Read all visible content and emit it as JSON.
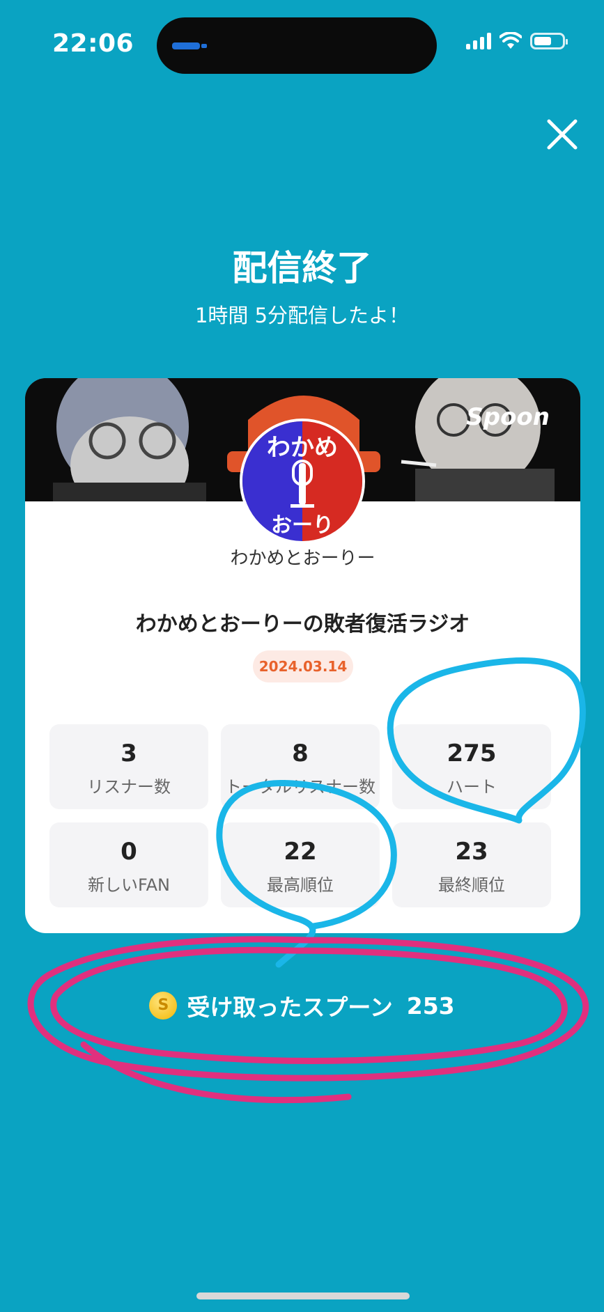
{
  "status": {
    "time": "22:06",
    "icons": [
      "signal-icon",
      "wifi-icon",
      "battery-icon"
    ]
  },
  "header": {
    "title": "配信終了",
    "subtitle": "1時間 5分配信したよ！",
    "close_icon": "close-icon"
  },
  "card": {
    "banner_brand": "Spoon",
    "avatar_text_top": "わかめ",
    "avatar_text_bottom": "おーり",
    "channel_name": "わかめとおーりー",
    "show_title": "わかめとおーりーの敗者復活ラジオ",
    "date": "2024.03.14",
    "stats": [
      {
        "value": "3",
        "label": "リスナー数"
      },
      {
        "value": "8",
        "label": "トータルリスナー数"
      },
      {
        "value": "275",
        "label": "ハート"
      },
      {
        "value": "0",
        "label": "新しいFAN"
      },
      {
        "value": "22",
        "label": "最高順位"
      },
      {
        "value": "23",
        "label": "最終順位"
      }
    ]
  },
  "spoons": {
    "coin_symbol": "S",
    "label": "受け取ったスプーン",
    "value": "253"
  },
  "colors": {
    "background": "#0aa3c2",
    "date_accent": "#e8622c",
    "annotation_blue": "#1ab6e8",
    "annotation_pink": "#e0307e"
  }
}
